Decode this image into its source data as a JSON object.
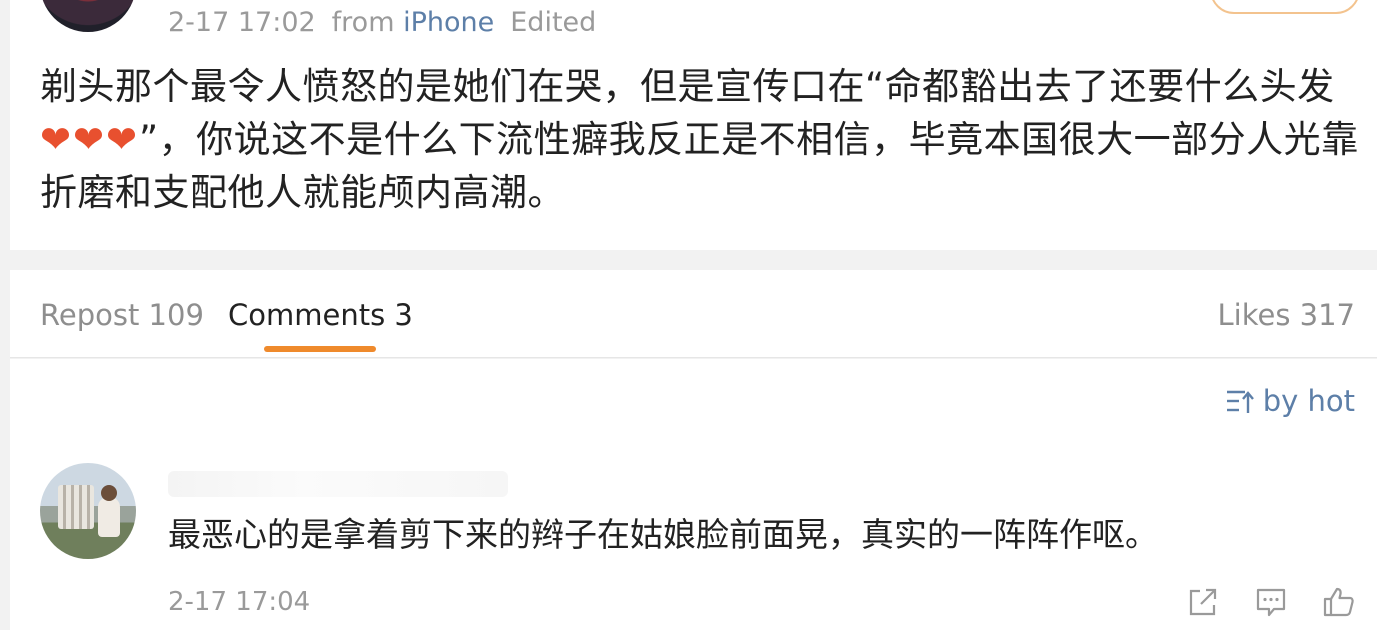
{
  "post": {
    "time": "2-17 17:02",
    "from_label": "from",
    "source": "iPhone",
    "edited": "Edited",
    "text_before_hearts": "剃头那个最令人愤怒的是她们在哭，但是宣传口在“命都豁出去了还要什么头发",
    "hearts": "❤❤❤",
    "text_after_hearts": "”，你说这不是什么下流性癖我反正是不相信，毕竟本国很大一部分人光靠折磨和支配他人就能颅内高潮。"
  },
  "tabs": {
    "repost": "Repost 109",
    "comments": "Comments 3",
    "likes": "Likes 317",
    "active": "comments"
  },
  "sort": {
    "label": "by hot",
    "icon": "sort-icon"
  },
  "comments": [
    {
      "text": "最恶心的是拿着剪下来的辫子在姑娘脸前面晃，真实的一阵阵作呕。",
      "time": "2-17 17:04",
      "actions": [
        "share-icon",
        "reply-icon",
        "like-icon"
      ]
    }
  ],
  "colors": {
    "accent": "#ef8a2c",
    "link": "#5d7fa8",
    "muted": "#9a9a9a",
    "text": "#222222",
    "heart": "#e8502f"
  }
}
